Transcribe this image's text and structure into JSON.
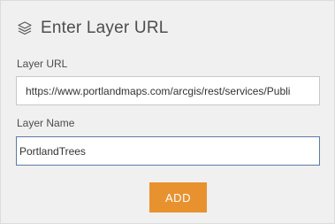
{
  "header": {
    "icon": "layers-icon",
    "title": "Enter Layer URL"
  },
  "form": {
    "url_label": "Layer URL",
    "url_value": "https://www.portlandmaps.com/arcgis/rest/services/Publi",
    "name_label": "Layer Name",
    "name_value": "PortlandTrees"
  },
  "actions": {
    "add_label": "ADD"
  },
  "colors": {
    "panel_bg": "#f0f0f0",
    "accent": "#e8922f",
    "focus_border": "#5c7aa3"
  }
}
